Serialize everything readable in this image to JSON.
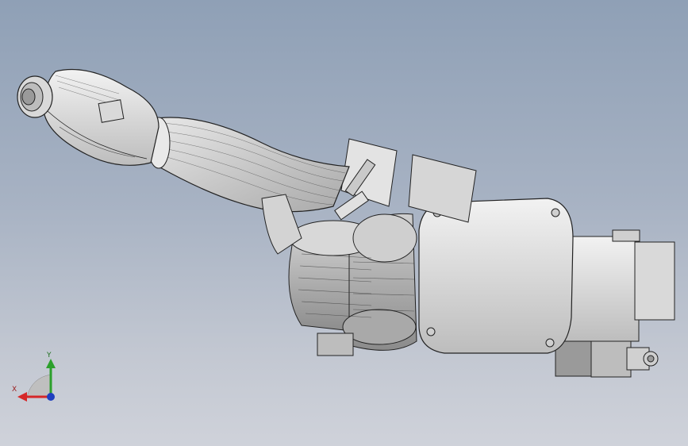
{
  "window": {
    "width": 867,
    "height": 562,
    "background_top": "#8fa0b6",
    "background_bottom": "#cfd2da"
  },
  "model": {
    "view": "isometric",
    "render_style": "shaded-with-edges",
    "part_color": "#dedede",
    "edge_color": "#222222"
  },
  "triad": {
    "y_label": "Y",
    "x_label": "X",
    "y_color": "#2ca02c",
    "x_color": "#d62728",
    "z_color": "#1f3fbf"
  }
}
